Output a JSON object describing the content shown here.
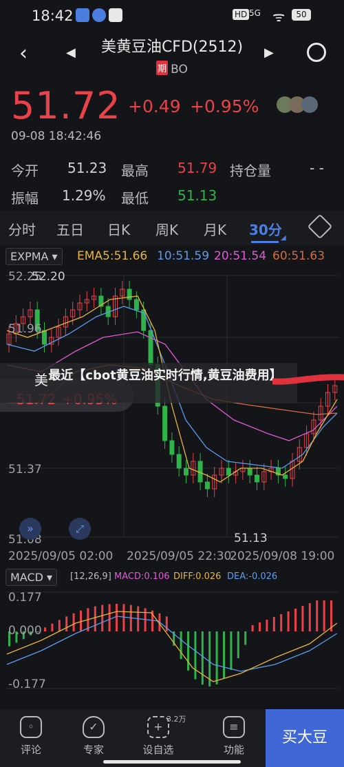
{
  "status_bar": {
    "time": "18:42",
    "network": "5G",
    "battery": "50"
  },
  "header": {
    "title": "美黄豆油CFD(2512)",
    "badge": "期",
    "code": "BO"
  },
  "quote": {
    "price": "51.72",
    "change": "+0.49",
    "change_pct": "+0.95%",
    "datetime": "09-08 18:42:46"
  },
  "stats": [
    {
      "label": "今开",
      "value": "51.23"
    },
    {
      "label": "最高",
      "value": "51.79"
    },
    {
      "label": "持仓量",
      "value": "- -"
    },
    {
      "label": "振幅",
      "value": "1.29%"
    },
    {
      "label": "最低",
      "value": "51.13"
    }
  ],
  "period_tabs": [
    "分时",
    "五日",
    "日K",
    "周K",
    "月K",
    "30分"
  ],
  "indicators": {
    "main_select": "EXPMA",
    "ema5": "EMA5:51.66",
    "ema10": "10:51.59",
    "ema20": "20:51.54",
    "ema60": "60:51.63",
    "sub_select": "MACD",
    "macd_params": "[12,26,9]",
    "macd": "MACD:0.106",
    "diff": "DIFF:0.026",
    "dea": "DEA:-0.026"
  },
  "chart_axes": {
    "y_high_left": "52.25",
    "y_high_mark": "52.20",
    "y_96": "51.96",
    "y_37": "51.37",
    "y_low": "51.08",
    "low_mark": "51.13",
    "x_labels": [
      "2025/09/05 02:00",
      "2025/09/05 22:30",
      "2025/09/08 19:00"
    ],
    "macd_top": "0.177",
    "macd_zero": "0.000",
    "macd_bottom": "-0.177"
  },
  "overlay": {
    "title": "最近【cbot黄豆油实时行情,黄豆油费用】",
    "bubble_prefix": "美",
    "bubble_price": "51.72",
    "bubble_change": "+0.95%"
  },
  "bottom_nav": [
    {
      "label": "评论"
    },
    {
      "label": "专家"
    },
    {
      "label": "设自选",
      "badge": "3.2万"
    },
    {
      "label": "功能"
    }
  ],
  "buy_button": "买大豆",
  "colors": {
    "up": "#e8434a",
    "down": "#2fb34a",
    "accent": "#4b7fe6"
  }
}
